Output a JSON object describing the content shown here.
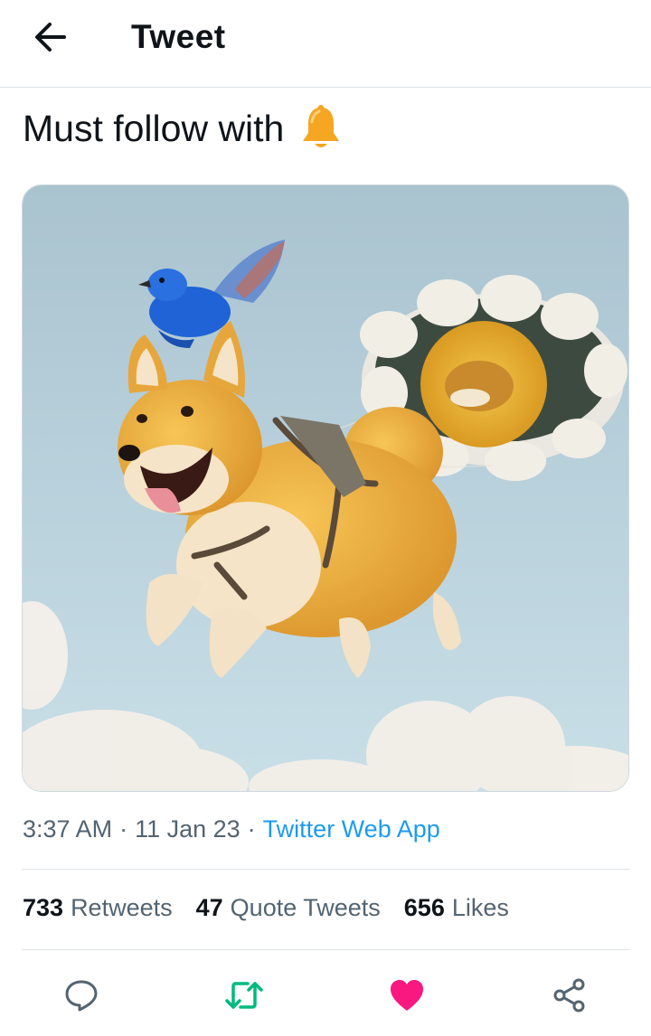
{
  "header": {
    "title": "Tweet",
    "back_icon": "arrow-left-icon"
  },
  "tweet": {
    "text": "Must follow with",
    "emoji_icon": "bell-icon",
    "media_description_icon": "image",
    "time": "3:37 AM",
    "date": "11 Jan 23",
    "separator": "·",
    "source": "Twitter Web App"
  },
  "stats": [
    {
      "count": "733",
      "label": "Retweets"
    },
    {
      "count": "47",
      "label": "Quote Tweets"
    },
    {
      "count": "656",
      "label": "Likes"
    }
  ],
  "actions": {
    "reply_icon": "comment-icon",
    "retweet_icon": "retweet-icon",
    "like_icon": "heart-filled-icon",
    "share_icon": "share-icon"
  },
  "colors": {
    "text_primary": "#0f1419",
    "text_secondary": "#536471",
    "link": "#1d9bf0",
    "retweet_green": "#00ba7c",
    "like_pink": "#f91880",
    "bell_yellow": "#f5a623",
    "divider": "#dfe3e6"
  }
}
